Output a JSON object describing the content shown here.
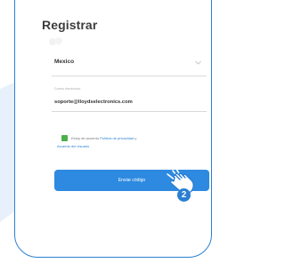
{
  "page": {
    "title": "Registrar",
    "accent_color": "#2a7fd4",
    "checkbox_color": "#4bb04b"
  },
  "form": {
    "country_value": "Mexico",
    "email_label": "Correo electrónico",
    "email_value": "soporte@lloydselectronics.com",
    "terms_prefix": "Estoy de acuerdo",
    "terms_link_1": "Política de privacidad",
    "terms_join": " y",
    "terms_link_2": "Acuerdo del Usuario",
    "submit_label": "Enviar código"
  },
  "annotation": {
    "step_number": "2"
  },
  "icons": {
    "dropdown": "chevron-down-icon",
    "pointer": "hand-pointer-icon",
    "logo": "faded-logo-icon"
  }
}
